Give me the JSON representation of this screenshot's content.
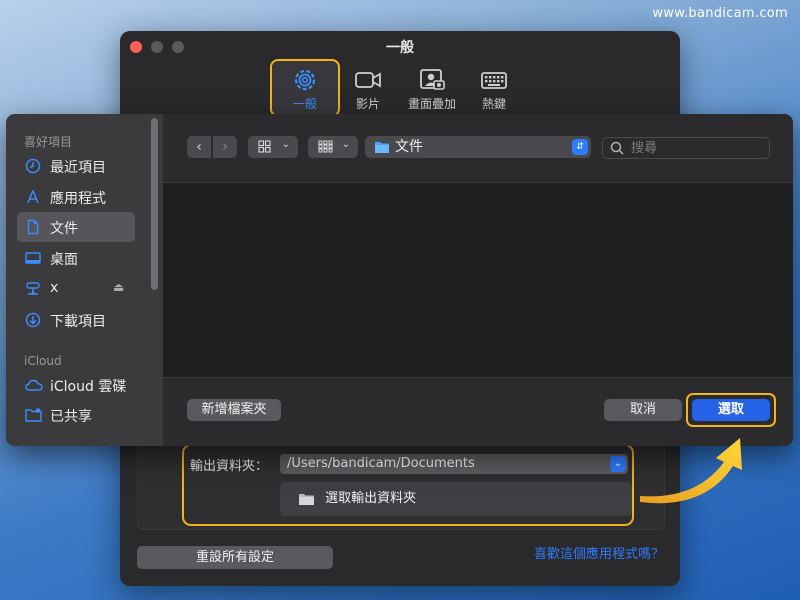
{
  "watermark": "www.bandicam.com",
  "window": {
    "title": "一般",
    "tabs": [
      {
        "label": "一般",
        "icon": "gear-icon",
        "active": true
      },
      {
        "label": "影片",
        "icon": "video-camera-icon"
      },
      {
        "label": "畫面疊加",
        "icon": "webcam-overlay-icon"
      },
      {
        "label": "熱鍵",
        "icon": "keyboard-icon"
      }
    ],
    "output": {
      "label": "輸出資料夾：",
      "path": "/Users/bandicam/Documents",
      "choose_label": "選取輸出資料夾"
    },
    "reset_label": "重設所有設定",
    "like_link": "喜歡這個應用程式嗎？"
  },
  "dialog": {
    "sidebar": {
      "favorites_header": "喜好項目",
      "favorites": [
        {
          "label": "最近項目",
          "icon": "clock-icon"
        },
        {
          "label": "應用程式",
          "icon": "apps-icon"
        },
        {
          "label": "文件",
          "icon": "document-icon",
          "selected": true
        },
        {
          "label": "桌面",
          "icon": "desktop-icon"
        },
        {
          "label": "x",
          "icon": "network-drive-icon"
        },
        {
          "label": "下載項目",
          "icon": "download-icon"
        }
      ],
      "icloud_header": "iCloud",
      "icloud": [
        {
          "label": "iCloud 雲碟",
          "icon": "cloud-icon"
        },
        {
          "label": "已共享",
          "icon": "shared-folder-icon"
        }
      ]
    },
    "toolbar": {
      "location": "文件",
      "search_placeholder": "搜尋"
    },
    "new_folder_label": "新增檔案夾",
    "cancel_label": "取消",
    "choose_label": "選取"
  },
  "colors": {
    "accent": "#2f7bff",
    "highlight": "#f4b21b"
  }
}
